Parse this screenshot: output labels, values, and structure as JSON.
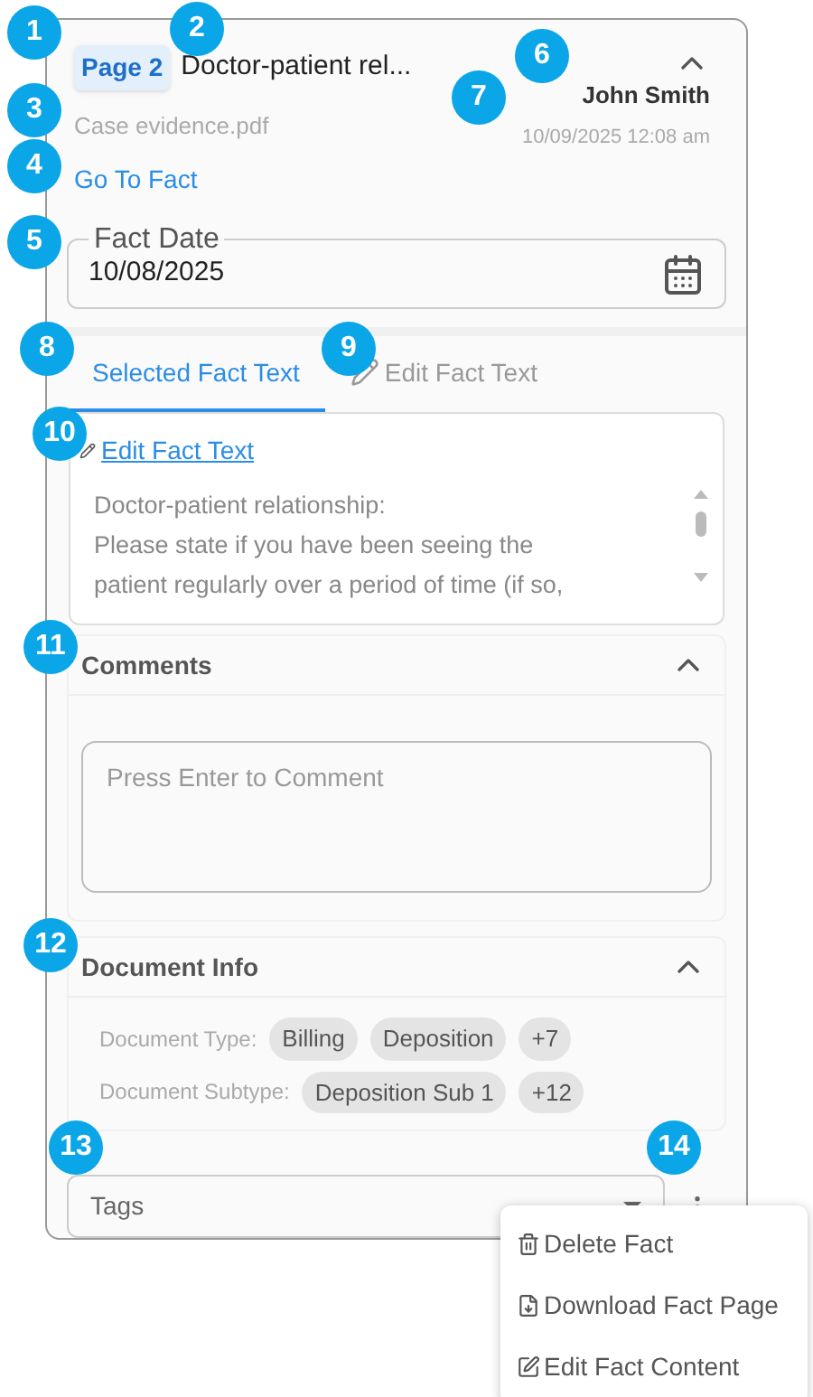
{
  "callouts": [
    "1",
    "2",
    "3",
    "4",
    "5",
    "6",
    "7",
    "8",
    "9",
    "10",
    "11",
    "12",
    "13",
    "14"
  ],
  "header": {
    "page_badge": "Page 2",
    "title": "Doctor-patient rel...",
    "file": "Case evidence.pdf",
    "link": "Go To Fact",
    "author": "John Smith",
    "timestamp": "10/09/2025 12:08 am",
    "expanded": true
  },
  "fact_date": {
    "label": "Fact Date",
    "value": "10/08/2025"
  },
  "tabs": [
    {
      "label": "Selected Fact Text",
      "selected": true
    },
    {
      "label": "Edit Fact Text",
      "selected": false
    }
  ],
  "fact_text": {
    "edit_link": "Edit Fact Text",
    "lines": [
      "Doctor-patient relationship:",
      "Please state if you have been seeing the",
      "patient regularly over a period of time (if so,"
    ]
  },
  "comments": {
    "title": "Comments",
    "expanded": true,
    "placeholder": "Press Enter to Comment"
  },
  "document_info": {
    "title": "Document Info",
    "expanded": true,
    "rows": [
      {
        "label": "Document Type:",
        "chips": [
          "Billing",
          "Deposition",
          "+7"
        ]
      },
      {
        "label": "Document Subtype:",
        "chips": [
          "Deposition Sub 1",
          "+12"
        ]
      }
    ]
  },
  "tags": {
    "placeholder": "Tags"
  },
  "menu": [
    {
      "kind": "delete",
      "label": "Delete Fact"
    },
    {
      "kind": "download",
      "label": "Download Fact Page"
    },
    {
      "kind": "edit",
      "label": "Edit Fact Content"
    }
  ]
}
